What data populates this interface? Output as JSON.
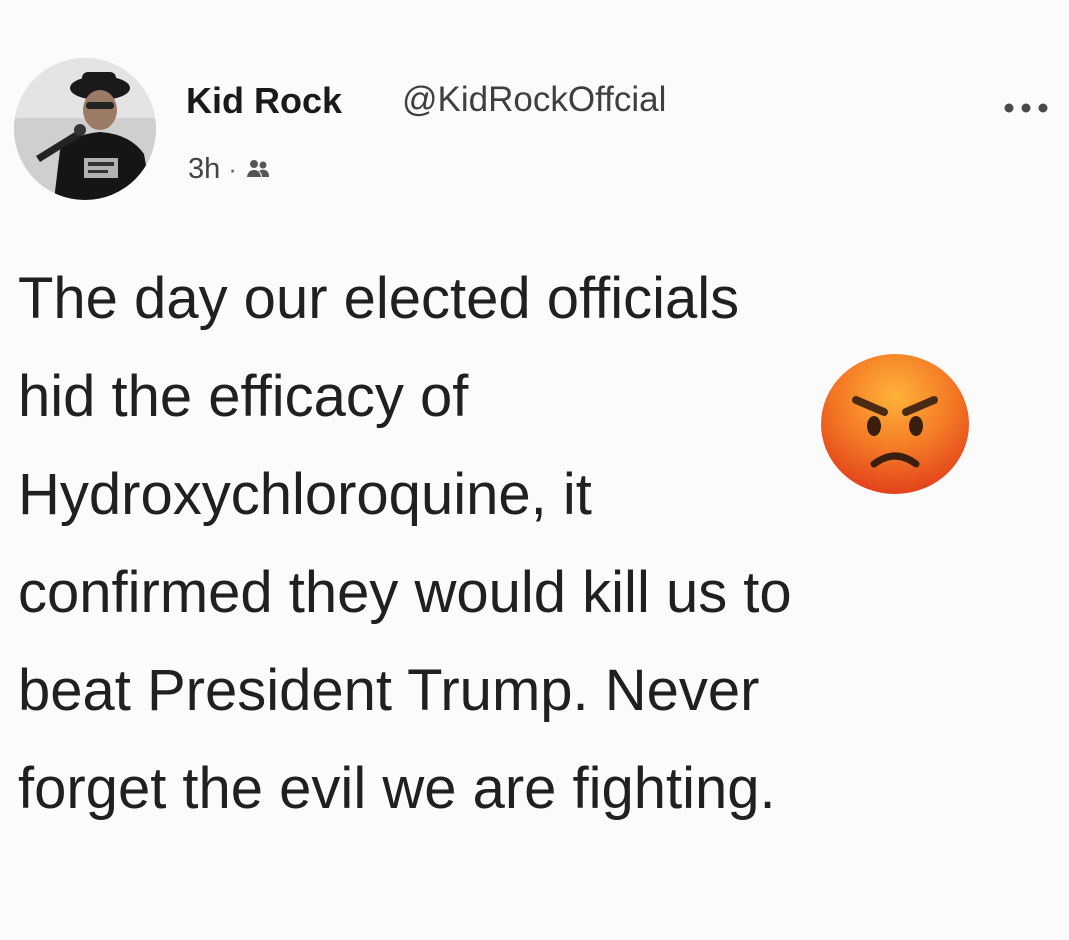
{
  "post": {
    "author": {
      "name": "Kid Rock",
      "handle": "@KidRockOffcial"
    },
    "timestamp": "3h",
    "separator": "·",
    "audience_icon": "friends-icon",
    "more_icon": "more-options-icon",
    "text_lines": [
      "The day our elected officials",
      "hid the efficacy of",
      "Hydroxychloroquine, it",
      "confirmed they would kill us to",
      "beat President Trump. Never",
      "forget the evil we are fighting."
    ],
    "emoji": "angry-face-emoji"
  },
  "colors": {
    "background": "#fbfbfb",
    "text": "#202020",
    "muted": "#444444",
    "emoji_orange": "#f05a20"
  }
}
